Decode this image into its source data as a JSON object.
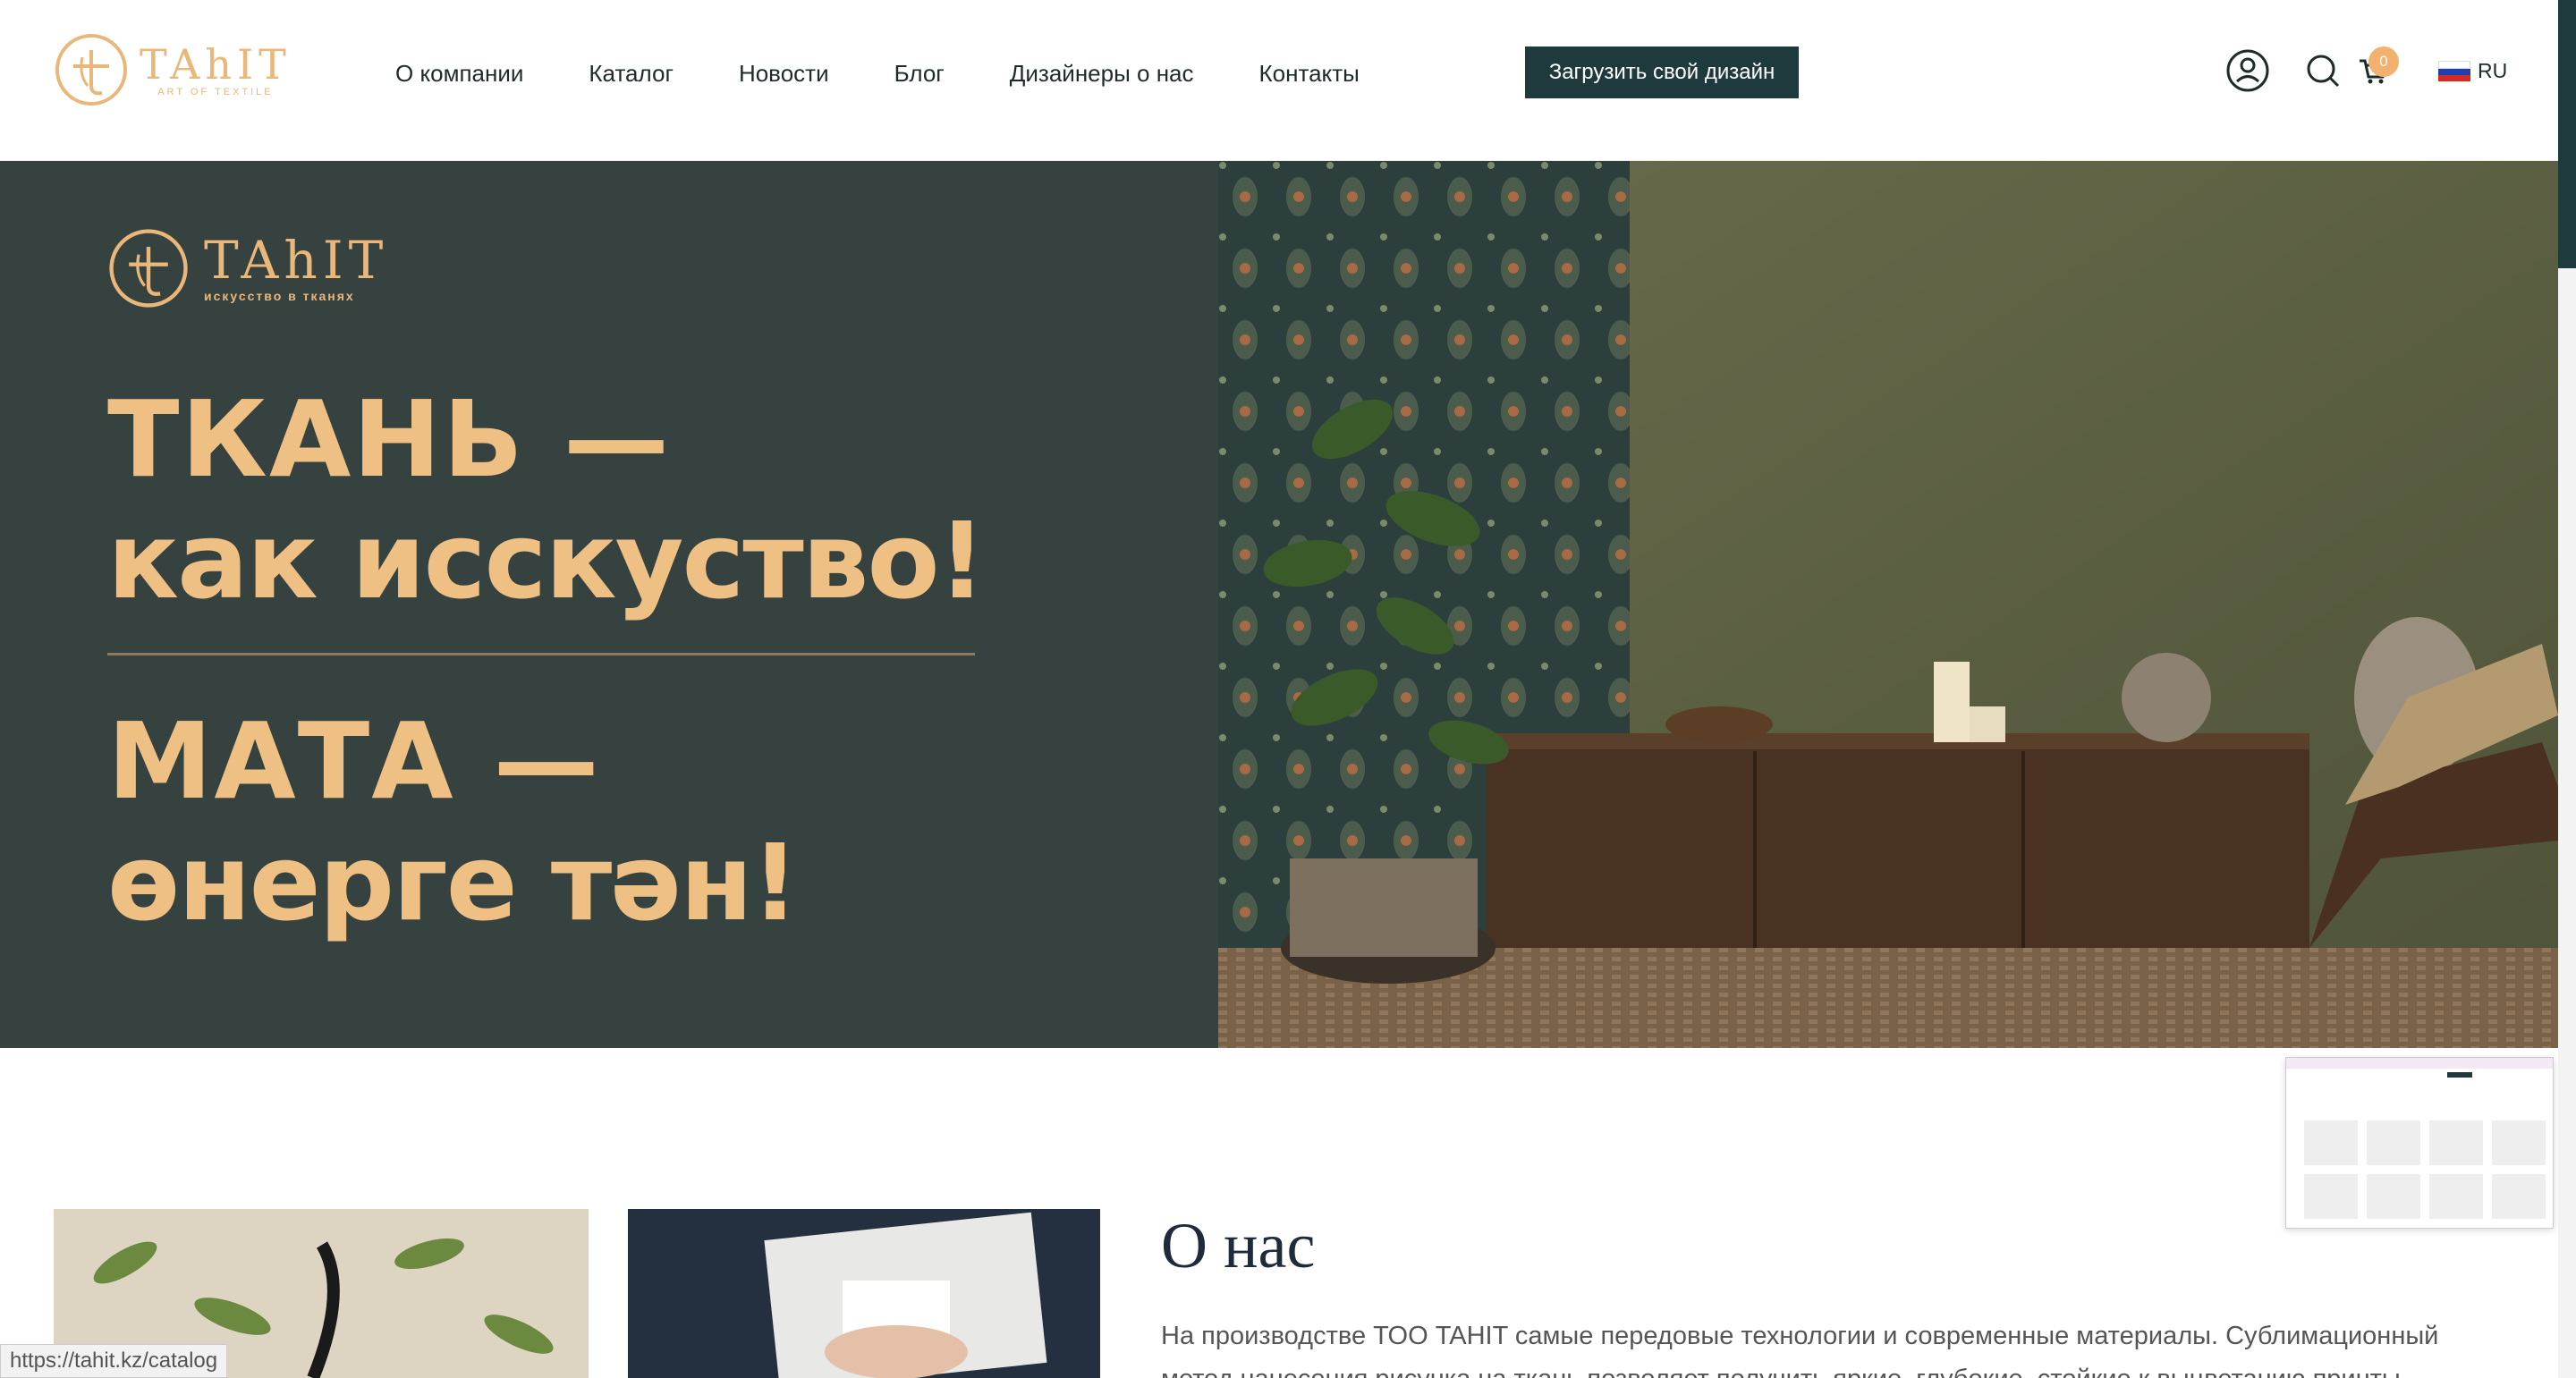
{
  "header": {
    "logo_word": "TAhIT",
    "logo_sub": "ART OF TEXTILE",
    "nav": [
      {
        "label": "О компании"
      },
      {
        "label": "Каталог"
      },
      {
        "label": "Новости"
      },
      {
        "label": "Блог"
      },
      {
        "label": "Дизайнеры о нас"
      },
      {
        "label": "Контакты"
      }
    ],
    "upload_label": "Загрузить свой дизайн",
    "cart_count": "0",
    "language": "RU"
  },
  "hero": {
    "logo_word": "TAhIT",
    "logo_sub": "искусство в тканях",
    "line1": "ТКАНЬ  —",
    "line2": "как исскуство!",
    "line3": "МАТА  —",
    "line4": "өнерге тән!",
    "bg_color": "#364240",
    "accent_color": "#eec083"
  },
  "about": {
    "title": "О нас",
    "text": "На производстве ТОО TAHIT самые передовые технологии и современные материалы. Сублимационный метод нанесения рисунка на ткань позволяет получить яркие, глубокие, стойкие к выцветанию принты. Фабрика оснащена"
  },
  "status_bar": {
    "url": "https://tahit.kz/catalog"
  },
  "colors": {
    "brand_dark": "#1e3a3c",
    "brand_gold": "#eab77a",
    "badge": "#f2b16e"
  }
}
